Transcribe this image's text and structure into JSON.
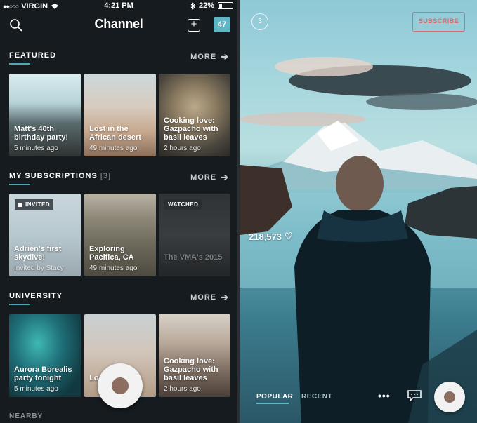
{
  "status_bar": {
    "carrier": "VIRGIN",
    "time": "4:21 PM",
    "battery": "22%",
    "battery_level": 0.22
  },
  "header": {
    "title": "Channel",
    "notification_count": "47"
  },
  "sections": [
    {
      "title": "FEATURED",
      "count": "",
      "more_label": "MORE",
      "cards": [
        {
          "title": "Matt's 40th birthday party!",
          "meta": "5 minutes ago",
          "tag": ""
        },
        {
          "title": "Lost in the African desert",
          "meta": "49 minutes ago",
          "tag": ""
        },
        {
          "title": "Cooking love: Gazpacho with basil leaves",
          "meta": "2 hours ago",
          "tag": ""
        }
      ]
    },
    {
      "title": "MY SUBSCRIPTIONS",
      "count": "[3]",
      "more_label": "MORE",
      "cards": [
        {
          "title": "Adrien's first skydive!",
          "meta": "Invited by Stacy",
          "tag": "INVITED"
        },
        {
          "title": "Exploring Pacifica, CA",
          "meta": "49 minutes ago",
          "tag": ""
        },
        {
          "title": "The VMA's 2015",
          "meta": "",
          "tag": "WATCHED"
        }
      ]
    },
    {
      "title": "UNIVERSITY",
      "count": "",
      "more_label": "MORE",
      "cards": [
        {
          "title": "Aurora Borealis party tonight",
          "meta": "5 minutes ago",
          "tag": ""
        },
        {
          "title": "Lo",
          "meta": "",
          "tag": ""
        },
        {
          "title": "Cooking love: Gazpacho with basil leaves",
          "meta": "2 hours ago",
          "tag": ""
        }
      ]
    }
  ],
  "nearby_label": "NEARBY",
  "detail": {
    "count": "3",
    "subscribe_label": "SUBSCRIBE",
    "likes": "218,573",
    "tabs": {
      "popular": "POPULAR",
      "recent": "RECENT"
    },
    "more_label": "•••"
  },
  "colors": {
    "accent": "#5fb7c5",
    "subscribe": "#e06a6a",
    "background": "#151b1f"
  }
}
